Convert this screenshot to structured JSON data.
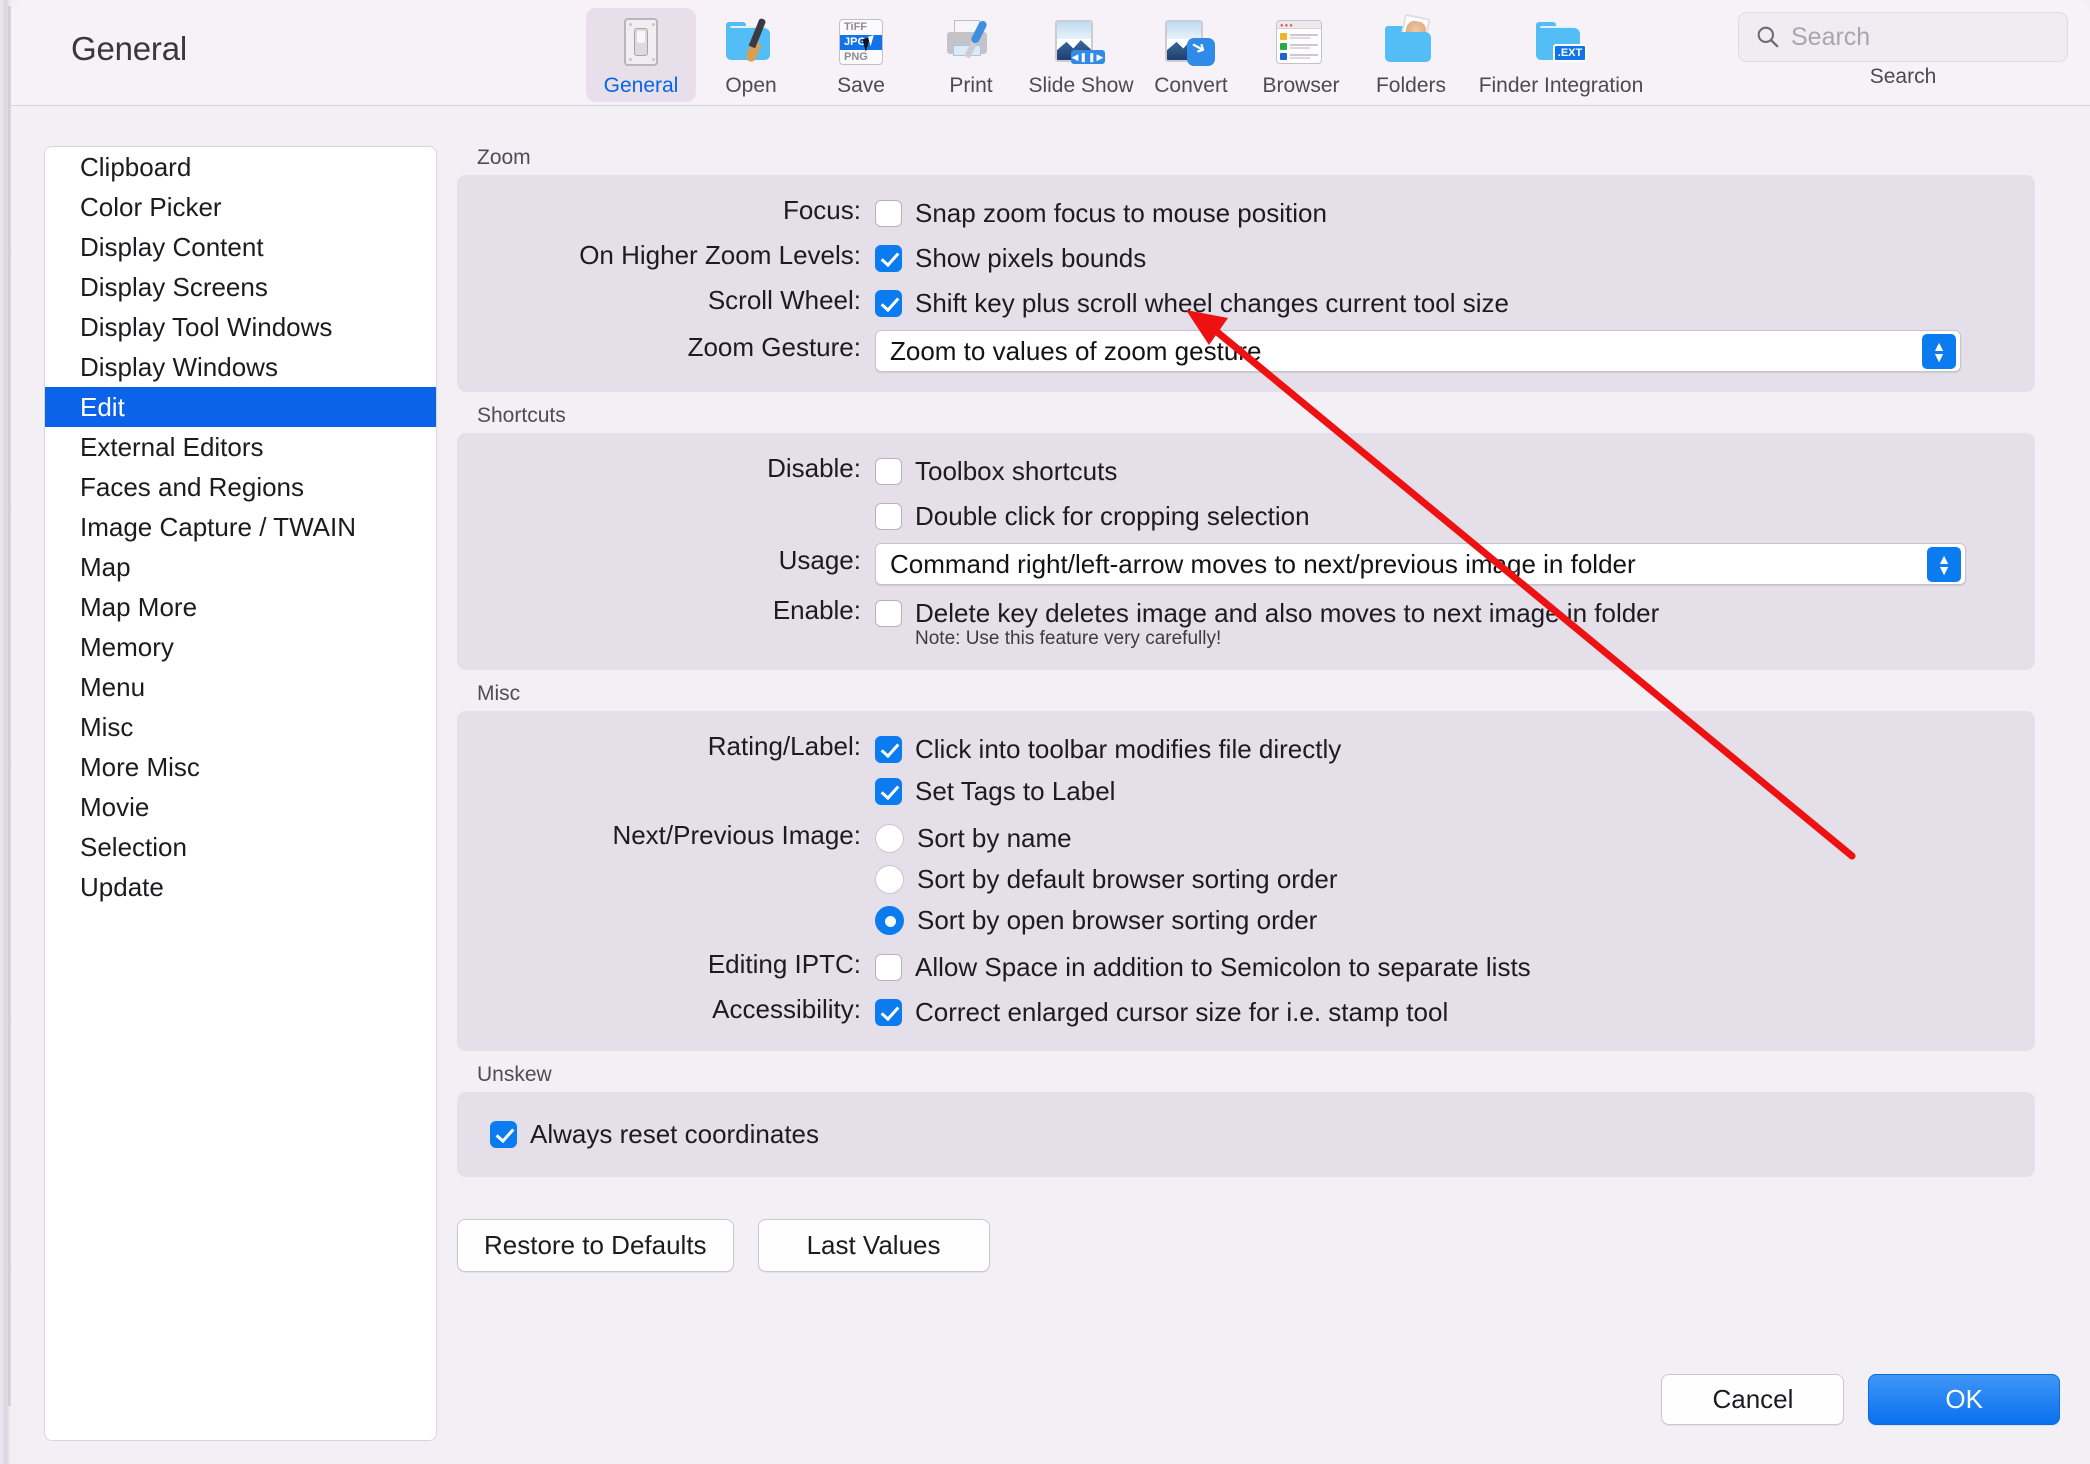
{
  "window": {
    "title": "General"
  },
  "toolbar": {
    "items": [
      {
        "label": "General",
        "icon": "general-switch-icon",
        "selected": true
      },
      {
        "label": "Open",
        "icon": "open-folder-brush-icon",
        "selected": false
      },
      {
        "label": "Save",
        "icon": "save-format-list-icon",
        "selected": false
      },
      {
        "label": "Print",
        "icon": "printer-icon",
        "selected": false
      },
      {
        "label": "Slide Show",
        "icon": "slide-show-icon",
        "selected": false
      },
      {
        "label": "Convert",
        "icon": "convert-icon",
        "selected": false
      },
      {
        "label": "Browser",
        "icon": "browser-window-icon",
        "selected": false
      },
      {
        "label": "Folders",
        "icon": "folders-photos-icon",
        "selected": false
      },
      {
        "label": "Finder Integration",
        "icon": "finder-integration-icon",
        "selected": false
      }
    ],
    "save_formats": [
      "TiFF",
      "JPG",
      "PNG"
    ],
    "save_selected_format": "JPG",
    "finder_ext_badge": ".EXT"
  },
  "search": {
    "placeholder": "Search",
    "value": "",
    "caption": "Search",
    "icon": "search-icon"
  },
  "sidebar": {
    "items": [
      {
        "label": "Clipboard",
        "selected": false
      },
      {
        "label": "Color Picker",
        "selected": false
      },
      {
        "label": "Display Content",
        "selected": false
      },
      {
        "label": "Display Screens",
        "selected": false
      },
      {
        "label": "Display Tool Windows",
        "selected": false
      },
      {
        "label": "Display Windows",
        "selected": false
      },
      {
        "label": "Edit",
        "selected": true
      },
      {
        "label": "External Editors",
        "selected": false
      },
      {
        "label": "Faces and Regions",
        "selected": false
      },
      {
        "label": "Image Capture / TWAIN",
        "selected": false
      },
      {
        "label": "Map",
        "selected": false
      },
      {
        "label": "Map More",
        "selected": false
      },
      {
        "label": "Memory",
        "selected": false
      },
      {
        "label": "Menu",
        "selected": false
      },
      {
        "label": "Misc",
        "selected": false
      },
      {
        "label": "More Misc",
        "selected": false
      },
      {
        "label": "Movie",
        "selected": false
      },
      {
        "label": "Selection",
        "selected": false
      },
      {
        "label": "Update",
        "selected": false
      }
    ]
  },
  "groups": {
    "zoom": {
      "title": "Zoom",
      "focus_label": "Focus:",
      "focus_option": "Snap zoom focus to mouse position",
      "focus_checked": false,
      "higher_label": "On Higher Zoom Levels:",
      "higher_option": "Show pixels bounds",
      "higher_checked": true,
      "scroll_label": "Scroll Wheel:",
      "scroll_option": "Shift key plus scroll wheel changes current tool size",
      "scroll_checked": true,
      "gesture_label": "Zoom Gesture:",
      "gesture_value": "Zoom to values of zoom gesture"
    },
    "shortcuts": {
      "title": "Shortcuts",
      "disable_label": "Disable:",
      "disable_option_1": "Toolbox shortcuts",
      "disable_option_1_checked": false,
      "disable_option_2": "Double click for cropping selection",
      "disable_option_2_checked": false,
      "usage_label": "Usage:",
      "usage_value": "Command right/left-arrow moves to next/previous image in folder",
      "enable_label": "Enable:",
      "enable_option": "Delete key deletes image and also moves to next image in folder",
      "enable_checked": false,
      "enable_note": "Note: Use this feature very carefully!"
    },
    "misc": {
      "title": "Misc",
      "rating_label": "Rating/Label:",
      "rating_option_1": "Click into toolbar modifies file directly",
      "rating_option_1_checked": true,
      "rating_option_2": "Set Tags to Label",
      "rating_option_2_checked": true,
      "nextprev_label": "Next/Previous Image:",
      "nextprev_option_1": "Sort by name",
      "nextprev_option_2": "Sort by default browser sorting order",
      "nextprev_option_3": "Sort by open browser sorting order",
      "nextprev_selected": 2,
      "iptc_label": "Editing IPTC:",
      "iptc_option": "Allow Space in addition to Semicolon to separate lists",
      "iptc_checked": false,
      "access_label": "Accessibility:",
      "access_option": "Correct enlarged cursor size for i.e. stamp tool",
      "access_checked": true
    },
    "unskew": {
      "title": "Unskew",
      "option": "Always reset coordinates",
      "checked": true
    }
  },
  "buttons": {
    "restore_defaults": "Restore to Defaults",
    "last_values": "Last Values",
    "cancel": "Cancel",
    "ok": "OK"
  },
  "colors": {
    "accent": "#0a7cf0",
    "selection": "#0a63e8",
    "annotation_arrow": "#ee1111",
    "window_bg": "#f3f0f5",
    "group_bg": "#e4dfe8"
  }
}
